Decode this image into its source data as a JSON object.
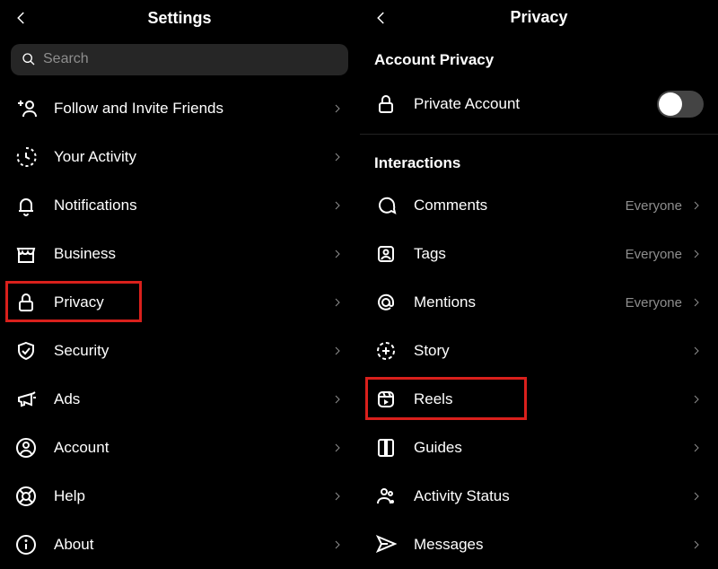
{
  "left": {
    "title": "Settings",
    "search_placeholder": "Search",
    "items": [
      {
        "label": "Follow and Invite Friends"
      },
      {
        "label": "Your Activity"
      },
      {
        "label": "Notifications"
      },
      {
        "label": "Business"
      },
      {
        "label": "Privacy",
        "highlight": true
      },
      {
        "label": "Security"
      },
      {
        "label": "Ads"
      },
      {
        "label": "Account"
      },
      {
        "label": "Help"
      },
      {
        "label": "About"
      }
    ]
  },
  "right": {
    "title": "Privacy",
    "section_account": "Account Privacy",
    "private_account_label": "Private Account",
    "private_account_on": false,
    "section_interactions": "Interactions",
    "items": [
      {
        "label": "Comments",
        "value": "Everyone"
      },
      {
        "label": "Tags",
        "value": "Everyone"
      },
      {
        "label": "Mentions",
        "value": "Everyone"
      },
      {
        "label": "Story"
      },
      {
        "label": "Reels",
        "highlight": true
      },
      {
        "label": "Guides"
      },
      {
        "label": "Activity Status"
      },
      {
        "label": "Messages"
      }
    ]
  }
}
